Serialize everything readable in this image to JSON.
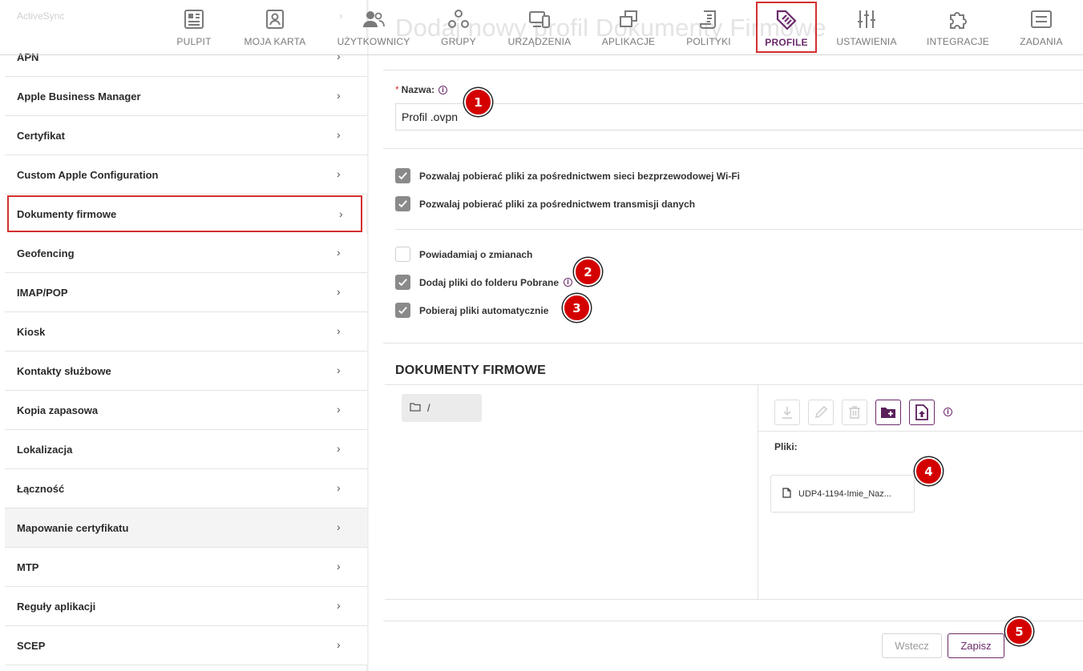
{
  "page_bg_title": "Dodaj nowy profil Dokumenty Firmowe",
  "topnav": {
    "items": [
      {
        "label": "PULPIT",
        "icon": "dashboard-icon"
      },
      {
        "label": "MOJA KARTA",
        "icon": "id-card-icon"
      },
      {
        "label": "UŻYTKOWNICY",
        "icon": "users-icon"
      },
      {
        "label": "GRUPY",
        "icon": "groups-icon"
      },
      {
        "label": "URZĄDZENIA",
        "icon": "devices-icon"
      },
      {
        "label": "APLIKACJE",
        "icon": "apps-icon"
      },
      {
        "label": "POLITYKI",
        "icon": "policy-icon"
      },
      {
        "label": "PROFILE",
        "icon": "profile-tag-icon",
        "active": true
      },
      {
        "label": "USTAWIENIA",
        "icon": "sliders-icon"
      },
      {
        "label": "INTEGRACJE",
        "icon": "puzzle-icon"
      },
      {
        "label": "ZADANIA",
        "icon": "tasks-icon"
      }
    ],
    "accent_color": "#6b2a6b",
    "highlight_color": "#d32f2f"
  },
  "sidebar": {
    "faded_item": "ActiveSync",
    "items": [
      {
        "label": "APN"
      },
      {
        "label": "Apple Business Manager"
      },
      {
        "label": "Certyfikat"
      },
      {
        "label": "Custom Apple Configuration"
      },
      {
        "label": "Dokumenty firmowe",
        "selected": true
      },
      {
        "label": "Geofencing"
      },
      {
        "label": "IMAP/POP"
      },
      {
        "label": "Kiosk"
      },
      {
        "label": "Kontakty służbowe"
      },
      {
        "label": "Kopia zapasowa"
      },
      {
        "label": "Lokalizacja"
      },
      {
        "label": "Łączność"
      },
      {
        "label": "Mapowanie certyfikatu",
        "hover": true
      },
      {
        "label": "MTP"
      },
      {
        "label": "Reguły aplikacji"
      },
      {
        "label": "SCEP"
      }
    ]
  },
  "form": {
    "name_label": "Nazwa:",
    "required_mark": "*",
    "name_value": "Profil .ovpn",
    "checkboxes": [
      {
        "label": "Pozwalaj pobierać pliki za pośrednictwem sieci bezprzewodowej Wi-Fi",
        "checked": true
      },
      {
        "label": "Pozwalaj pobierać pliki za pośrednictwem transmisji danych",
        "checked": true
      },
      {
        "label": "Powiadamiaj o zmianach",
        "checked": false
      },
      {
        "label": "Dodaj pliki do folderu Pobrane",
        "checked": true,
        "info": true
      },
      {
        "label": "Pobieraj pliki automatycznie",
        "checked": true
      }
    ]
  },
  "documents": {
    "section_title": "DOKUMENTY FIRMOWE",
    "folder_root": "/",
    "toolbar": {
      "download": "download-icon",
      "edit": "pencil-icon",
      "delete": "trash-icon",
      "new_folder": "folder-plus-icon",
      "upload": "file-upload-icon"
    },
    "files_label": "Pliki:",
    "files": [
      {
        "name": "UDP4-1194-Imie_Naz..."
      }
    ]
  },
  "actions": {
    "back_label": "Wstecz",
    "save_label": "Zapisz"
  },
  "badges": [
    "1",
    "2",
    "3",
    "4",
    "5"
  ]
}
